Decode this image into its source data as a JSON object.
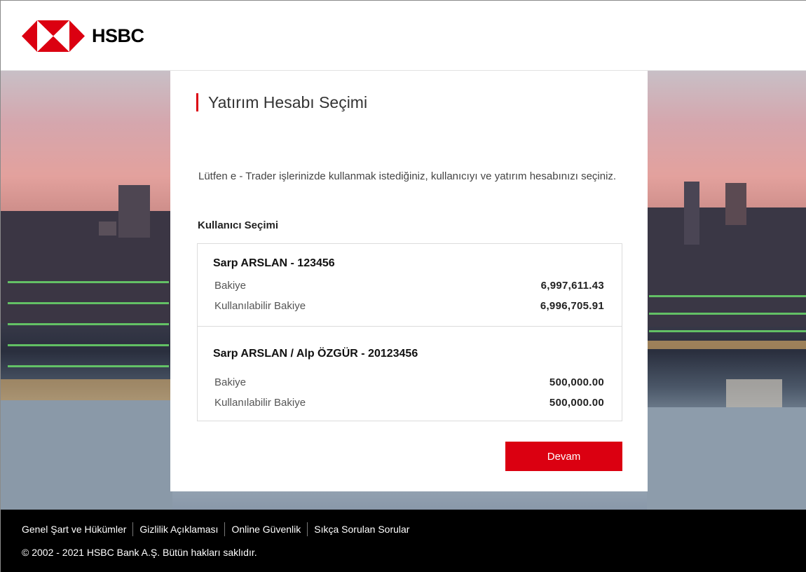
{
  "brand": {
    "name": "HSBC",
    "colors": {
      "red": "#db0011",
      "dark": "#000000"
    },
    "logo_icon": "hsbc-hexagon-logo"
  },
  "card": {
    "title": "Yatırım Hesabı Seçimi",
    "intro": "Lütfen e - Trader işlerinizde kullanmak istediğiniz, kullanıcıyı ve yatırım hesabınızı seçiniz.",
    "section_label": "Kullanıcı Seçimi",
    "accounts": [
      {
        "name": "Sarp ARSLAN - 123456",
        "balance_label": "Bakiye",
        "balance": "6,997,611.43",
        "available_label": "Kullanılabilir Bakiye",
        "available": "6,996,705.91"
      },
      {
        "name": "Sarp ARSLAN / Alp ÖZGÜR - 20123456",
        "balance_label": "Bakiye",
        "balance": "500,000.00",
        "available_label": "Kullanılabilir Bakiye",
        "available": "500,000.00"
      }
    ],
    "continue_label": "Devam"
  },
  "footer": {
    "links": [
      "Genel Şart ve Hükümler",
      "Gizlilik Açıklaması",
      "Online Güvenlik",
      "Sıkça Sorulan Sorular"
    ],
    "copyright": "© 2002 - 2021 HSBC Bank A.Ş. Bütün hakları saklıdır."
  }
}
